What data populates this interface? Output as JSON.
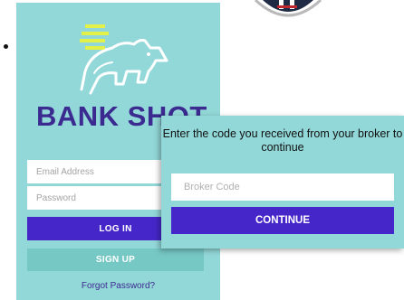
{
  "brand": {
    "name": "BANK SHOT",
    "logo_icon": "rhino-icon",
    "color": "#3b2a8f"
  },
  "login_form": {
    "email_placeholder": "Email Address",
    "password_placeholder": "Password",
    "login_label": "LOG IN",
    "signup_label": "SIGN UP",
    "forgot_label": "Forgot Password?"
  },
  "broker_dialog": {
    "message": "Enter the code you received from your broker to continue",
    "code_placeholder": "Broker Code",
    "continue_label": "CONTINUE"
  },
  "colors": {
    "background": "#93d8d8",
    "primary_button": "#4527c9",
    "secondary_button": "#76c8c5",
    "accent_stripes": "#e4f04a"
  }
}
